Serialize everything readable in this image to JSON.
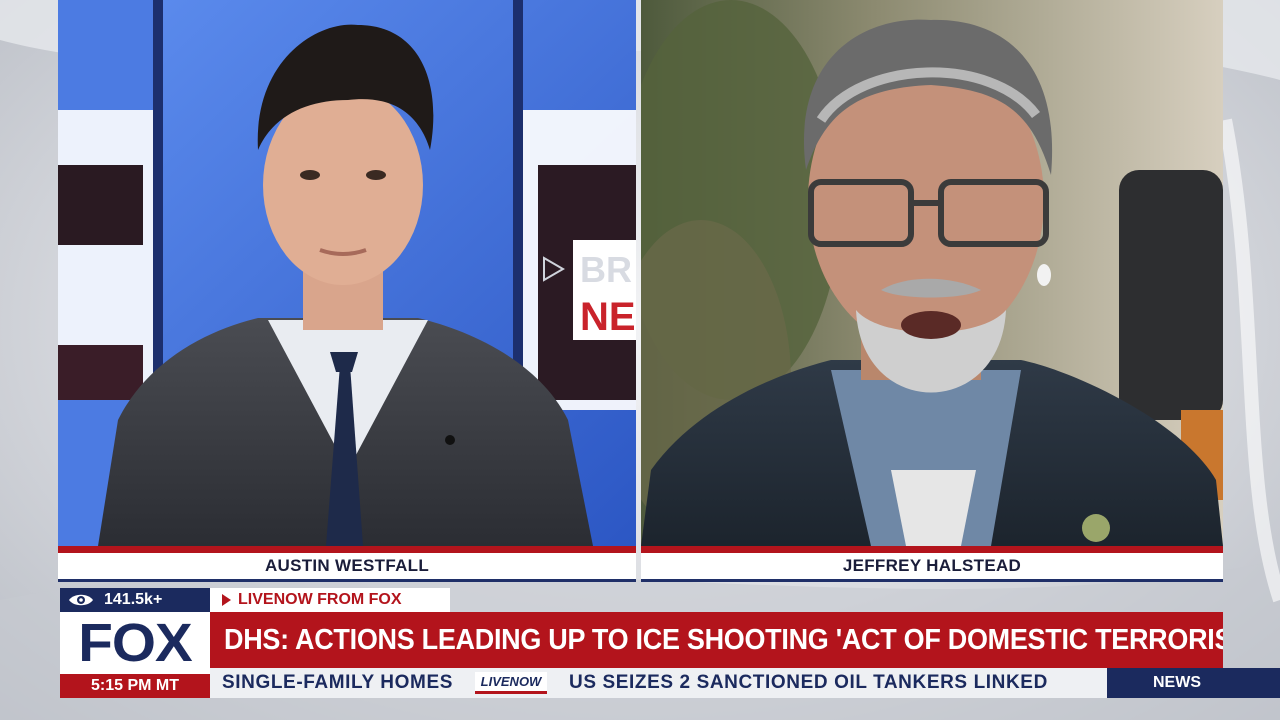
{
  "panes": {
    "left": {
      "studio_text_top": "BR",
      "studio_text_bottom": "NE"
    }
  },
  "name_strips": {
    "left": "AUSTIN WESTFALL",
    "right": "JEFFREY HALSTEAD"
  },
  "lower_third": {
    "viewers": "141.5k+",
    "viewer_icon": "eye-icon",
    "logo": "FOX",
    "time": "5:15 PM MT",
    "tag": "LIVENOW FROM FOX",
    "headline": "DHS: ACTIONS LEADING UP TO ICE SHOOTING 'ACT OF DOMESTIC TERRORISM'",
    "ticker": {
      "item1": "SINGLE-FAMILY HOMES",
      "logo": "LIVENOW",
      "item2": "US SEIZES 2 SANCTIONED OIL TANKERS LINKED"
    },
    "tab": "NEWS"
  },
  "colors": {
    "brand_red": "#b3141c",
    "brand_navy": "#1b2a5e",
    "studio_blue": "#3f6fd8"
  }
}
